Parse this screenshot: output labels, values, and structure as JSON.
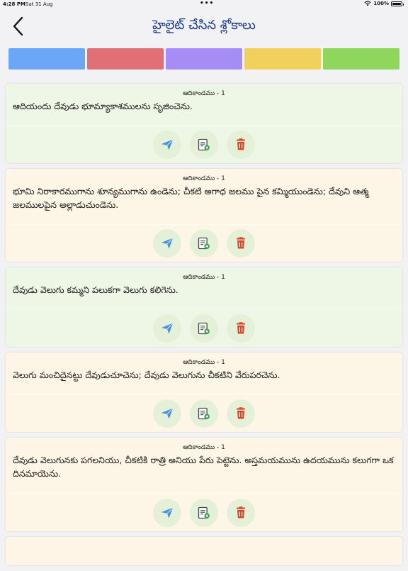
{
  "status": {
    "time": "4:28 PM",
    "date": "Sat 31 Aug",
    "battery": "100%",
    "battery_level": 1.0
  },
  "header": {
    "title": "హైలైట్ చేసిన శ్లోకాలు"
  },
  "colors": {
    "swatches": [
      "#6ca6f7",
      "#e07075",
      "#a68cf5",
      "#f1d05c",
      "#8fd65c"
    ],
    "icon_bg": "#e4f1d8",
    "send": "#4a8fe0",
    "note": "#4a4a4a",
    "note_badge": "#3fa35a",
    "delete": "#d64a2a",
    "title": "#1b3a8f"
  },
  "cards": [
    {
      "ref": "ఆదికాండము - 1",
      "text": "ఆదియందు దేవుడు భూమ్యాకాశములను సృజించెను.",
      "bg": "#eef6e6"
    },
    {
      "ref": "ఆదికాండము - 1",
      "text": "భూమి నిరాకారముగాను శూన్యముగాను ఉండెను; చీకటి అగాధ జలము పైన కమ్మియుండెను; దేవుని ఆత్మ జలములపైన అల్లాడుచుండెను.",
      "bg": "#fdf6e6"
    },
    {
      "ref": "ఆదికాండము - 1",
      "text": "దేవుడు వెలుగు కమ్మని పలుకగా వెలుగు కలిగెను.",
      "bg": "#eef6e6"
    },
    {
      "ref": "ఆదికాండము - 1",
      "text": "వెలుగు మంచిదైనట్టు దేవుడుచూచెను; దేవుడు వెలుగును చీకటిని వేరుపరచెను.",
      "bg": "#fdf6e6"
    },
    {
      "ref": "ఆదికాండము - 1",
      "text": "దేవుడు వెలుగునకు పగలనియు, చీకటికి రాత్రి అనియు పేరు పెట్టెను. అస్తమయమును ఉదయమును కలుగగా ఒక దినమాయెను.",
      "bg": "#fdf6e6"
    }
  ]
}
